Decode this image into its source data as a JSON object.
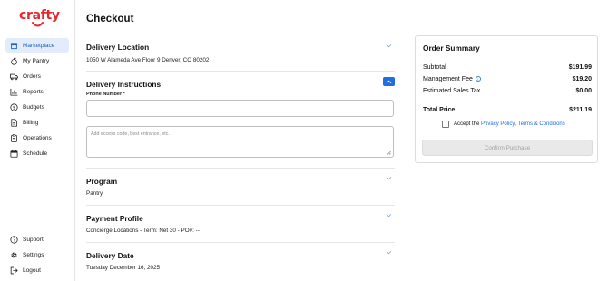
{
  "brand": {
    "logo_text": "crafty",
    "color": "#e8262d"
  },
  "sidebar": {
    "items": [
      {
        "label": "Marketplace",
        "icon": "storefront-icon",
        "active": true
      },
      {
        "label": "My Pantry",
        "icon": "apple-icon"
      },
      {
        "label": "Orders",
        "icon": "truck-icon"
      },
      {
        "label": "Reports",
        "icon": "bar-chart-icon"
      },
      {
        "label": "Budgets",
        "icon": "dollar-circle-icon"
      },
      {
        "label": "Billing",
        "icon": "document-icon"
      },
      {
        "label": "Operations",
        "icon": "clipboard-icon"
      },
      {
        "label": "Schedule",
        "icon": "calendar-icon"
      }
    ],
    "bottom_items": [
      {
        "label": "Support",
        "icon": "help-icon"
      },
      {
        "label": "Settings",
        "icon": "gear-icon"
      },
      {
        "label": "Logout",
        "icon": "logout-icon"
      }
    ]
  },
  "page": {
    "title": "Checkout"
  },
  "delivery_location": {
    "title": "Delivery Location",
    "value": "1050 W Alameda Ave Floor 9 Denver, CO 80202"
  },
  "delivery_instructions": {
    "title": "Delivery Instructions",
    "phone_label": "Phone Number *",
    "phone_value": "",
    "notes_placeholder": "Add access code, best entrance, etc."
  },
  "program": {
    "title": "Program",
    "value": "Pantry"
  },
  "payment_profile": {
    "title": "Payment Profile",
    "value": "Concierge Locations - Term: Net 30 - PO#: --"
  },
  "delivery_date": {
    "title": "Delivery Date",
    "value": "Tuesday December 16, 2025"
  },
  "order_summary": {
    "title": "Order Summary",
    "subtotal_label": "Subtotal",
    "subtotal_value": "$191.99",
    "management_fee_label": "Management Fee",
    "management_fee_value": "$19.20",
    "sales_tax_label": "Estimated Sales Tax",
    "sales_tax_value": "$0.00",
    "total_label": "Total Price",
    "total_value": "$211.19",
    "accept_prefix": "Accept the",
    "privacy_link": "Privacy Policy",
    "accept_join": ",",
    "terms_link": "Terms & Conditions",
    "confirm_label": "Confirm Purchase"
  },
  "colors": {
    "accent": "#1f6fe0",
    "active_bg": "#e3ecfa",
    "brand": "#e8262d"
  }
}
